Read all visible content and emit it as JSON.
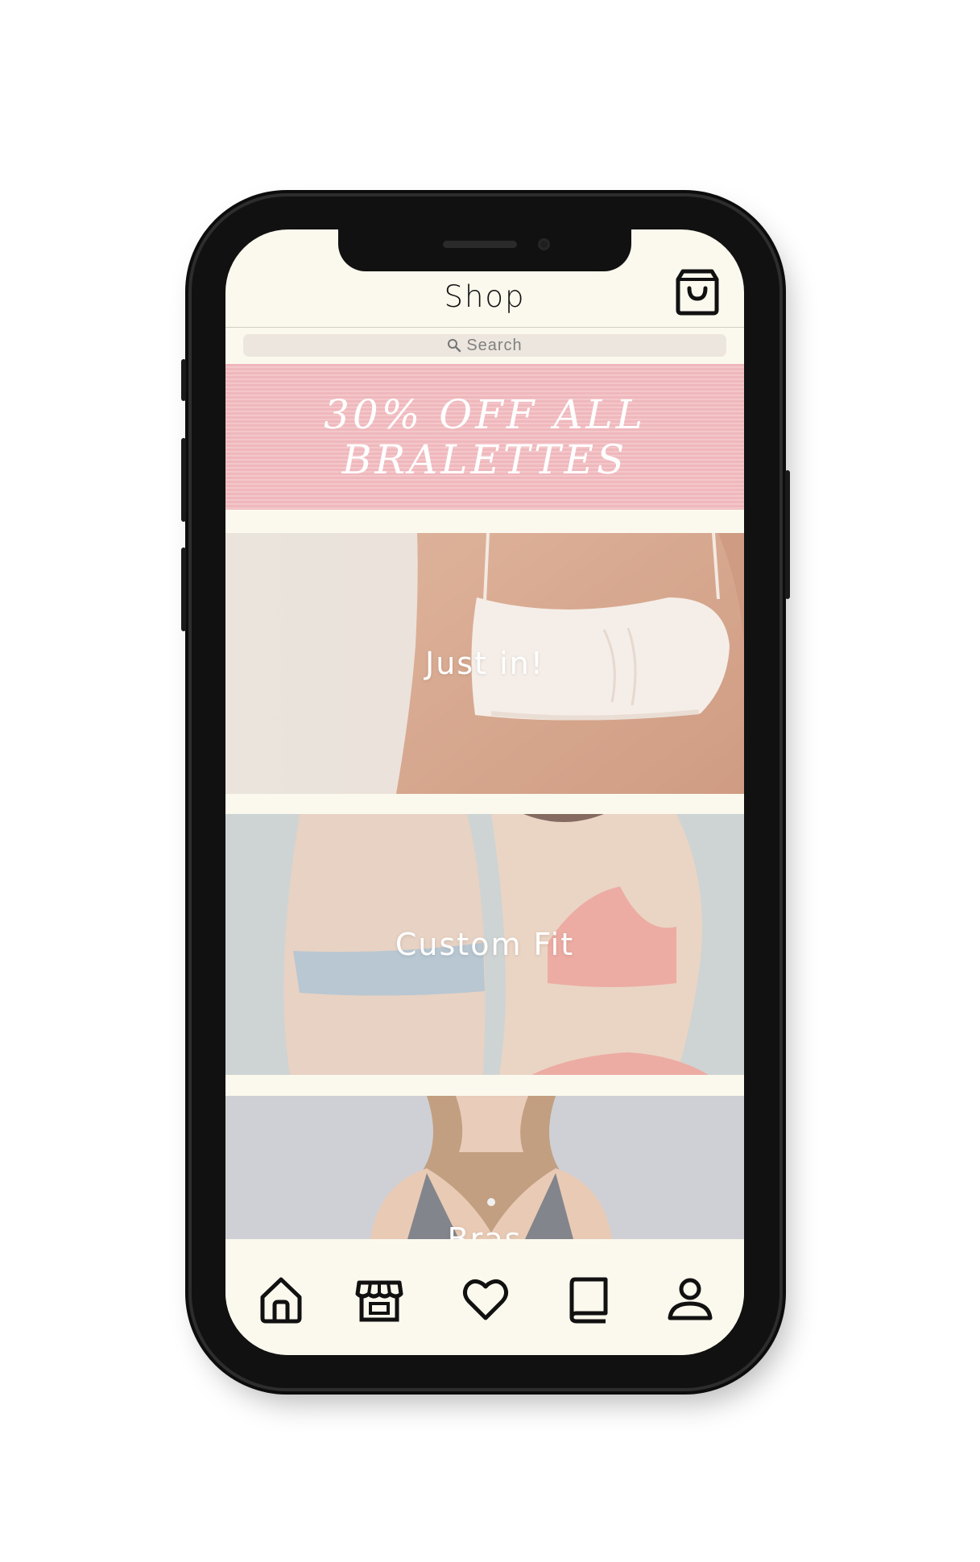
{
  "header": {
    "title": "Shop",
    "cart_icon": "shopping-bag-icon"
  },
  "search": {
    "placeholder": "Search",
    "icon": "search-icon"
  },
  "promo": {
    "line1": "30% OFF ALL",
    "line2": "BRALETTES"
  },
  "categories": [
    {
      "label": "Just in!"
    },
    {
      "label": "Custom Fit"
    },
    {
      "label": "Bras"
    }
  ],
  "tabbar": {
    "items": [
      {
        "icon": "home-icon"
      },
      {
        "icon": "store-icon"
      },
      {
        "icon": "heart-icon"
      },
      {
        "icon": "book-icon"
      },
      {
        "icon": "profile-icon"
      }
    ]
  },
  "colors": {
    "background": "#fbf8ee",
    "promo_pink": "#efb8bd",
    "search_bg": "#ece6de",
    "text_dark": "#111111"
  }
}
